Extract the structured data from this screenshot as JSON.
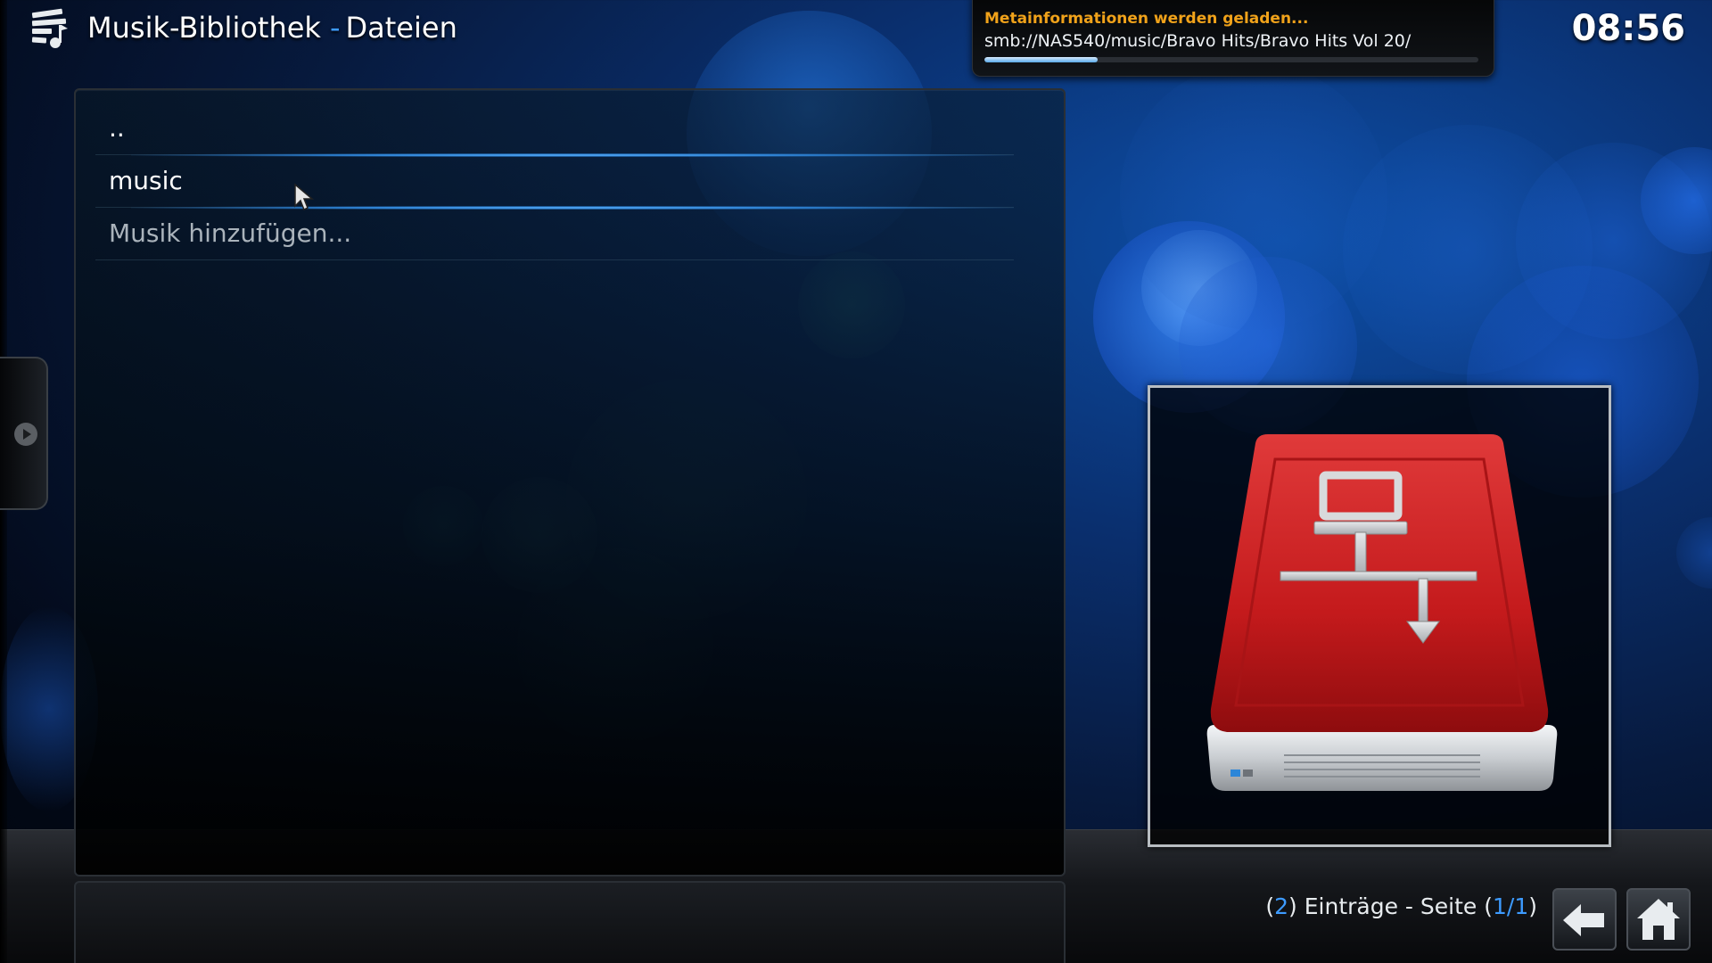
{
  "header": {
    "section": "Musik-Bibliothek",
    "separator": "-",
    "subsection": "Dateien",
    "clock": "08:56"
  },
  "notification": {
    "title": "Metainformationen werden geladen...",
    "path": "smb://NAS540/music/Bravo Hits/Bravo Hits Vol 20/",
    "progress_percent": 23
  },
  "list": {
    "items": [
      {
        "label": "..",
        "focused": false
      },
      {
        "label": "music",
        "focused": true
      },
      {
        "label": "Musik hinzufügen...",
        "focused": false
      }
    ]
  },
  "status": {
    "count_open": "(",
    "count": "2",
    "count_close": ")",
    "entries_text": " Einträge - Seite ",
    "page_open": "(",
    "page": "1/1",
    "page_close": ")"
  },
  "colors": {
    "accent": "#3d9bff",
    "notification_title": "#f0a21a",
    "drive_red": "#c8181c"
  },
  "icons": {
    "logo": "music-library-icon",
    "thumbnail": "network-drive-icon",
    "back": "back-arrow-icon",
    "home": "home-icon",
    "side": "play-icon"
  }
}
